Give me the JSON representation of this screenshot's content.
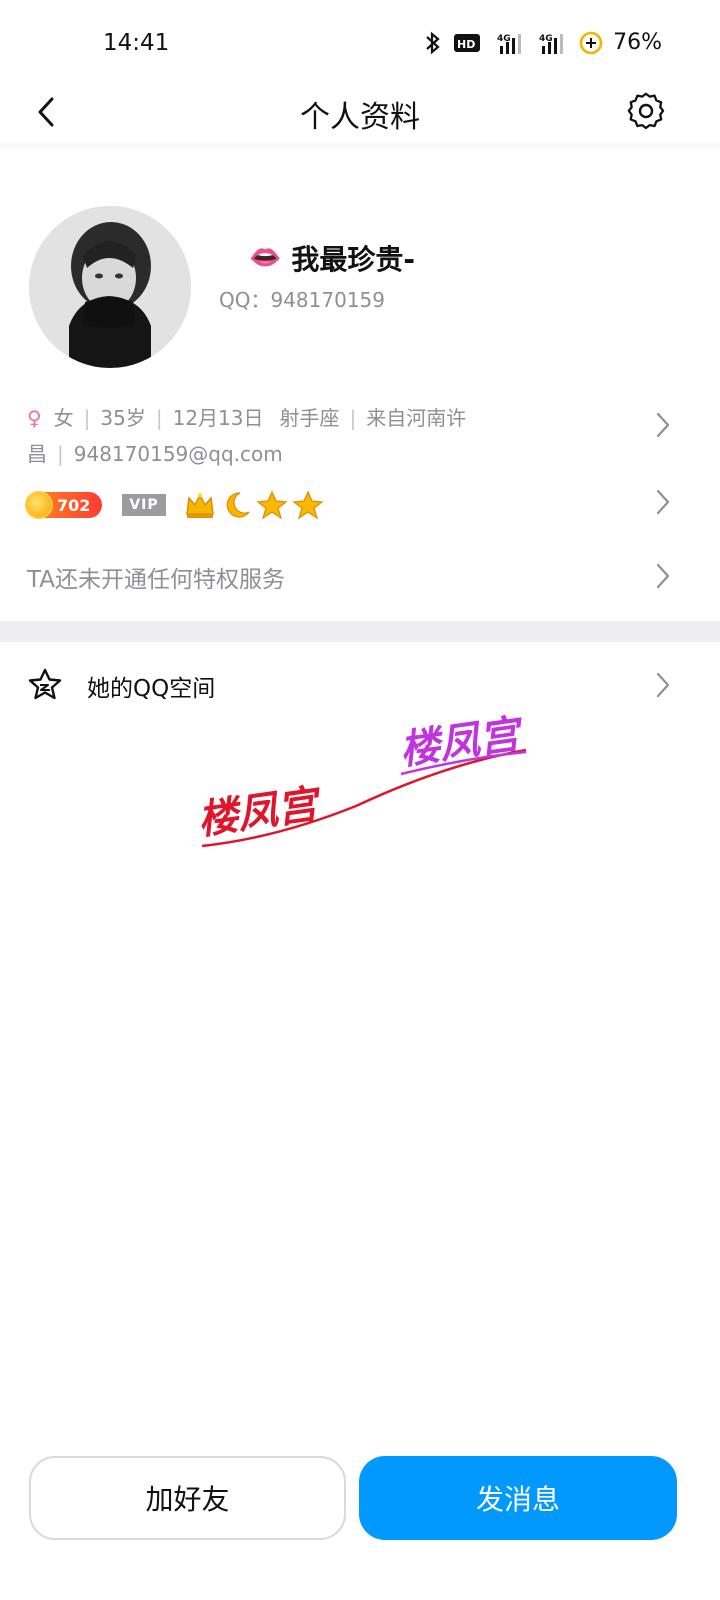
{
  "status_bar": {
    "time": "14:41",
    "battery": "76%",
    "icons": [
      "bluetooth-icon",
      "hd-voice-icon",
      "signal-4g-icon",
      "signal-4g-icon",
      "battery-saver-icon"
    ]
  },
  "header": {
    "title": "个人资料",
    "back_icon": "chevron-left-icon",
    "settings_icon": "gear-icon"
  },
  "profile": {
    "nickname_emoji": "👄",
    "nickname": "我最珍贵-",
    "qq_label": "QQ：948170159",
    "details": {
      "gender_symbol": "♀",
      "gender": "女",
      "age": "35岁",
      "birthday": "12月13日",
      "zodiac": "射手座",
      "location": "来自河南许昌",
      "email": "948170159@qq.com"
    },
    "level": "702",
    "vip_label": "VIP",
    "medals": [
      "crown-icon",
      "moon-icon",
      "star-icon",
      "star-icon"
    ],
    "privilege_text": "TA还未开通任何特权服务"
  },
  "qzone": {
    "label": "她的QQ空间",
    "icon": "star-outline-icon"
  },
  "watermark": {
    "text1": "楼凤宫",
    "text2": "楼凤宫"
  },
  "actions": {
    "add_friend": "加好友",
    "send_message": "发消息"
  },
  "colors": {
    "primary_button": "#0299fe",
    "female": "#f06ea9",
    "secondary_text": "#8f8f94"
  }
}
